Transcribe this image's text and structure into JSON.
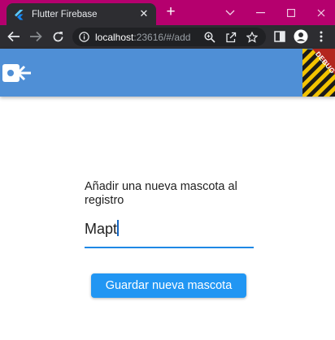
{
  "browser": {
    "tab_title": "Flutter Firebase",
    "url_host": "localhost",
    "url_rest": ":23616/#/add"
  },
  "appbar": {
    "back_icon": "back-logout-icon",
    "debug_banner": "DEBUG"
  },
  "form": {
    "label": "Añadir una nueva mascota al registro",
    "input_value": "Mapt",
    "save_label": "Guardar nueva mascota"
  },
  "colors": {
    "titlebar": "#b5006e",
    "toolbar": "#2d2d31",
    "appbar": "#4f8fd6",
    "accent": "#2196f3"
  }
}
